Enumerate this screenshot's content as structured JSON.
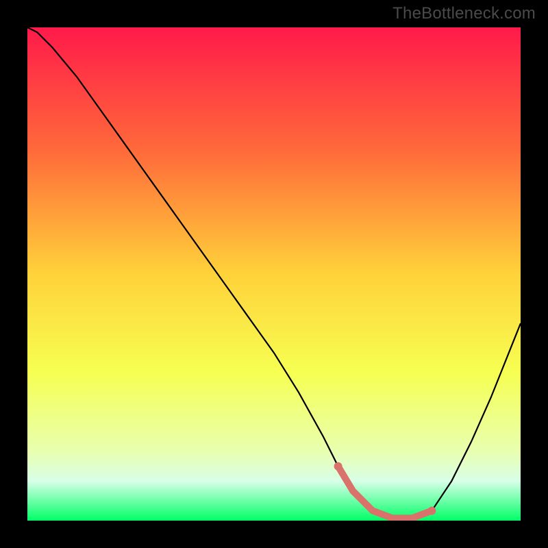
{
  "watermark": "TheBottleneck.com",
  "chart_data": {
    "type": "line",
    "title": "",
    "xlabel": "",
    "ylabel": "",
    "xlim": [
      0,
      100
    ],
    "ylim": [
      0,
      100
    ],
    "gradient_stops": [
      {
        "offset": 0,
        "color": "#ff1a4a"
      },
      {
        "offset": 25,
        "color": "#ff6a3a"
      },
      {
        "offset": 50,
        "color": "#ffd23a"
      },
      {
        "offset": 70,
        "color": "#f6ff52"
      },
      {
        "offset": 86,
        "color": "#e8ffb0"
      },
      {
        "offset": 92,
        "color": "#d8ffe8"
      },
      {
        "offset": 100,
        "color": "#00ff66"
      }
    ],
    "series": [
      {
        "name": "bottleneck-curve",
        "stroke": "#000000",
        "x": [
          0,
          2,
          5,
          10,
          15,
          20,
          25,
          30,
          35,
          40,
          45,
          50,
          55,
          60,
          63,
          66,
          70,
          74,
          78,
          82,
          86,
          90,
          94,
          100
        ],
        "y": [
          100,
          99,
          96,
          90,
          83,
          76,
          69,
          62,
          55,
          48,
          41,
          34,
          26,
          17,
          11,
          6,
          2,
          0.5,
          0.5,
          2,
          8,
          16,
          25,
          40
        ]
      }
    ],
    "highlight_segment": {
      "color": "#d9726b",
      "x": [
        63,
        66,
        70,
        74,
        78,
        82
      ],
      "y": [
        11,
        6,
        2,
        0.5,
        0.5,
        2
      ]
    }
  }
}
